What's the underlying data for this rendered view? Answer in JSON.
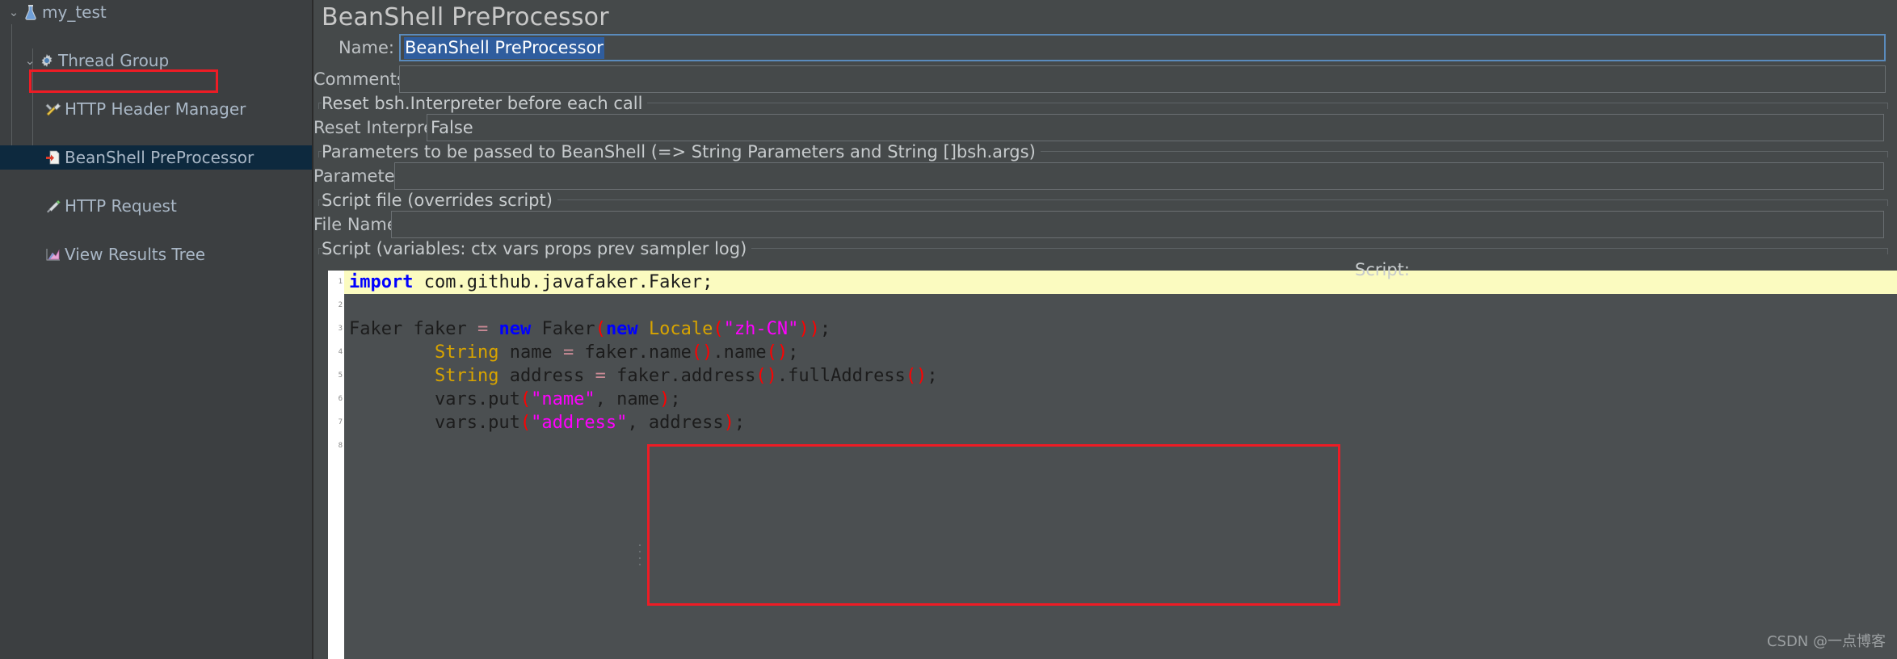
{
  "tree": {
    "items": [
      {
        "label": "my_test",
        "icon": "flask-icon",
        "level": 0,
        "expanded": true,
        "selected": false
      },
      {
        "label": "Thread Group",
        "icon": "gear-icon",
        "level": 1,
        "expanded": true,
        "selected": false
      },
      {
        "label": "HTTP Header Manager",
        "icon": "tools-icon",
        "level": 2,
        "expanded": null,
        "selected": false
      },
      {
        "label": "BeanShell PreProcessor",
        "icon": "document-icon",
        "level": 2,
        "expanded": null,
        "selected": true
      },
      {
        "label": "HTTP Request",
        "icon": "pen-icon",
        "level": 2,
        "expanded": null,
        "selected": false
      },
      {
        "label": "View Results Tree",
        "icon": "chart-icon",
        "level": 2,
        "expanded": null,
        "selected": false
      }
    ]
  },
  "panel": {
    "title": "BeanShell PreProcessor",
    "fields": {
      "name_label": "Name:",
      "name_value": "BeanShell PreProcessor",
      "comments_label": "Comments:",
      "comments_value": "",
      "reset_group_title": "Reset bsh.Interpreter before each call",
      "reset_interpreter_label": "Reset Interpreter:",
      "reset_interpreter_value": "False",
      "parameters_group_title": "Parameters to be passed to BeanShell (=> String Parameters and String []bsh.args)",
      "parameters_label": "Parameters:",
      "parameters_value": "",
      "script_file_group_title": "Script file (overrides script)",
      "file_name_label": "File Name:",
      "file_name_value": "",
      "script_group_title": "Script (variables: ctx vars props prev sampler log)"
    },
    "script_caption": "Script:"
  },
  "editor": {
    "gutter": [
      "1",
      "2",
      "3",
      "4",
      "5",
      "6",
      "7",
      "8"
    ],
    "lines": [
      {
        "highlight": true,
        "tokens": [
          {
            "t": "import",
            "c": "tok-kw"
          },
          {
            "t": " com.github.javafaker.Faker;",
            "c": "tok-plain"
          }
        ]
      },
      {
        "highlight": false,
        "tokens": [
          {
            "t": "",
            "c": "tok-plain"
          }
        ]
      },
      {
        "highlight": false,
        "tokens": [
          {
            "t": "Faker faker ",
            "c": "tok-plain"
          },
          {
            "t": "=",
            "c": "tok-op"
          },
          {
            "t": " ",
            "c": "tok-plain"
          },
          {
            "t": "new",
            "c": "tok-kw"
          },
          {
            "t": " Faker",
            "c": "tok-plain"
          },
          {
            "t": "(",
            "c": "tok-paren"
          },
          {
            "t": "new",
            "c": "tok-kw"
          },
          {
            "t": " ",
            "c": "tok-plain"
          },
          {
            "t": "Locale",
            "c": "tok-type"
          },
          {
            "t": "(",
            "c": "tok-paren"
          },
          {
            "t": "\"zh-CN\"",
            "c": "tok-str"
          },
          {
            "t": ")",
            "c": "tok-paren"
          },
          {
            "t": ")",
            "c": "tok-paren"
          },
          {
            "t": ";",
            "c": "tok-plain"
          }
        ]
      },
      {
        "highlight": false,
        "tokens": [
          {
            "t": "        ",
            "c": "tok-plain"
          },
          {
            "t": "String",
            "c": "tok-type"
          },
          {
            "t": " name ",
            "c": "tok-plain"
          },
          {
            "t": "=",
            "c": "tok-op"
          },
          {
            "t": " faker.name",
            "c": "tok-plain"
          },
          {
            "t": "()",
            "c": "tok-paren"
          },
          {
            "t": ".name",
            "c": "tok-plain"
          },
          {
            "t": "()",
            "c": "tok-paren"
          },
          {
            "t": ";",
            "c": "tok-plain"
          }
        ]
      },
      {
        "highlight": false,
        "tokens": [
          {
            "t": "        ",
            "c": "tok-plain"
          },
          {
            "t": "String",
            "c": "tok-type"
          },
          {
            "t": " address ",
            "c": "tok-plain"
          },
          {
            "t": "=",
            "c": "tok-op"
          },
          {
            "t": " faker.address",
            "c": "tok-plain"
          },
          {
            "t": "()",
            "c": "tok-paren"
          },
          {
            "t": ".fullAddress",
            "c": "tok-plain"
          },
          {
            "t": "()",
            "c": "tok-paren"
          },
          {
            "t": ";",
            "c": "tok-plain"
          }
        ]
      },
      {
        "highlight": false,
        "tokens": [
          {
            "t": "        vars.put",
            "c": "tok-plain"
          },
          {
            "t": "(",
            "c": "tok-paren"
          },
          {
            "t": "\"name\"",
            "c": "tok-str"
          },
          {
            "t": ", name",
            "c": "tok-plain"
          },
          {
            "t": ")",
            "c": "tok-paren"
          },
          {
            "t": ";",
            "c": "tok-plain"
          }
        ]
      },
      {
        "highlight": false,
        "tokens": [
          {
            "t": "        vars.put",
            "c": "tok-plain"
          },
          {
            "t": "(",
            "c": "tok-paren"
          },
          {
            "t": "\"address\"",
            "c": "tok-str"
          },
          {
            "t": ", address",
            "c": "tok-plain"
          },
          {
            "t": ")",
            "c": "tok-paren"
          },
          {
            "t": ";",
            "c": "tok-plain"
          }
        ]
      },
      {
        "highlight": false,
        "tokens": [
          {
            "t": "",
            "c": "tok-plain"
          }
        ]
      }
    ]
  },
  "watermark": "CSDN @一点博客",
  "colors": {
    "panel_bg": "#45494a",
    "tree_bg": "#3c3f41",
    "selection_bg": "#0d293e",
    "annotation_red": "#ee1c25",
    "text_selection_blue": "#2f5d9e",
    "editor_bg": "#4b4f51",
    "current_line": "#fbfbc0"
  }
}
